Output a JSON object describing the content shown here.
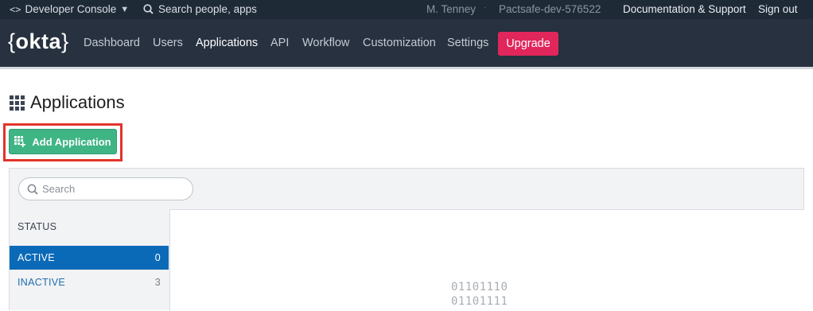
{
  "topbar": {
    "console_label": "Developer Console",
    "search_label": "Search people, apps",
    "user_name": "M. Tenney",
    "separator": "·",
    "org_name": "Pactsafe-dev-576522",
    "docs_label": "Documentation & Support",
    "signout_label": "Sign out"
  },
  "navbar": {
    "logo_text": "okta",
    "items": [
      {
        "label": "Dashboard"
      },
      {
        "label": "Users"
      },
      {
        "label": "Applications"
      },
      {
        "label": "API"
      },
      {
        "label": "Workflow"
      },
      {
        "label": "Customization"
      },
      {
        "label": "Settings"
      }
    ],
    "active_item": "Applications",
    "upgrade_label": "Upgrade"
  },
  "page": {
    "title": "Applications",
    "add_button_label": "Add Application"
  },
  "apps_panel": {
    "search_placeholder": "Search",
    "status_heading": "STATUS",
    "filters": [
      {
        "label": "ACTIVE",
        "count": "0"
      },
      {
        "label": "INACTIVE",
        "count": "3"
      }
    ],
    "empty_state_lines": [
      "01101110",
      "01101111"
    ]
  },
  "colors": {
    "topbar_bg": "#1f2a37",
    "navbar_bg": "#27313f",
    "upgrade_button": "#e1265b",
    "add_button": "#3fb585",
    "highlight_outline": "#e1342a",
    "active_filter_bg": "#0b6ab8"
  },
  "icons": {
    "console": "code-brackets-icon",
    "console_caret": "caret-down-icon",
    "search": "search-icon",
    "page_title": "grid-icon",
    "add_button": "add-app-grid-icon"
  }
}
